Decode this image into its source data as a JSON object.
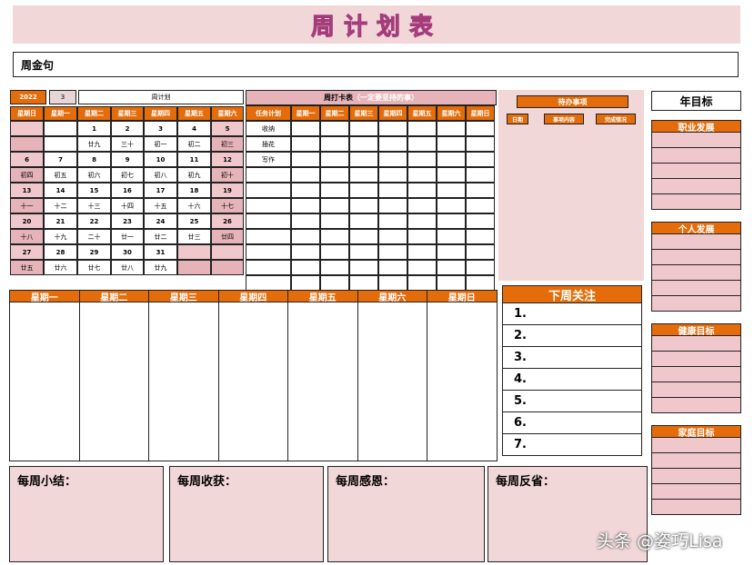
{
  "title": "周计划表",
  "motto_label": "周金句",
  "calendar": {
    "year": "2022",
    "month": "3",
    "plan_label": "周计划",
    "weekdays": [
      "星期日",
      "星期一",
      "星期二",
      "星期三",
      "星期四",
      "星期五",
      "星期六"
    ],
    "weeks": [
      {
        "dates": [
          "",
          "",
          "1",
          "2",
          "3",
          "4",
          "5"
        ],
        "lunar": [
          "",
          "",
          "廿九",
          "三十",
          "初一",
          "初二",
          "初三"
        ]
      },
      {
        "dates": [
          "6",
          "7",
          "8",
          "9",
          "10",
          "11",
          "12"
        ],
        "lunar": [
          "初四",
          "初五",
          "初六",
          "初七",
          "初八",
          "初九",
          "初十"
        ]
      },
      {
        "dates": [
          "13",
          "14",
          "15",
          "16",
          "17",
          "18",
          "19"
        ],
        "lunar": [
          "十一",
          "十二",
          "十三",
          "十四",
          "十五",
          "十六",
          "十七"
        ]
      },
      {
        "dates": [
          "20",
          "21",
          "22",
          "23",
          "24",
          "25",
          "26"
        ],
        "lunar": [
          "十八",
          "十九",
          "二十",
          "廿一",
          "廿二",
          "廿三",
          "廿四"
        ]
      },
      {
        "dates": [
          "27",
          "28",
          "29",
          "30",
          "31",
          "",
          ""
        ],
        "lunar": [
          "廿五",
          "廿六",
          "廿七",
          "廿八",
          "廿九",
          "",
          ""
        ]
      }
    ]
  },
  "check": {
    "title": "周打卡表",
    "subtitle": "（一定要坚持的事）",
    "task_header": "任务计划",
    "weekdays": [
      "星期一",
      "星期二",
      "星期三",
      "星期四",
      "星期五",
      "星期六",
      "星期日"
    ],
    "tasks": [
      "收纳",
      "插花",
      "写作",
      "",
      "",
      "",
      "",
      "",
      "",
      "",
      ""
    ]
  },
  "todo": {
    "title": "待办事项",
    "cols": [
      "日期",
      "事项内容",
      "完成情况"
    ]
  },
  "year_goals": {
    "title": "年目标",
    "sections": [
      "职业发展",
      "个人发展",
      "健康目标",
      "家庭目标"
    ]
  },
  "week_columns": [
    "星期一",
    "星期二",
    "星期三",
    "星期四",
    "星期五",
    "星期六",
    "星期日"
  ],
  "next_week": {
    "title": "下周关注",
    "items": [
      "1.",
      "2.",
      "3.",
      "4.",
      "5.",
      "6.",
      "7."
    ]
  },
  "summary": {
    "s1": "每周小结：",
    "s2": "每周收获：",
    "s3": "每周感恩：",
    "s4": "每周反省："
  },
  "watermark": "头条 @姿巧Lisa"
}
